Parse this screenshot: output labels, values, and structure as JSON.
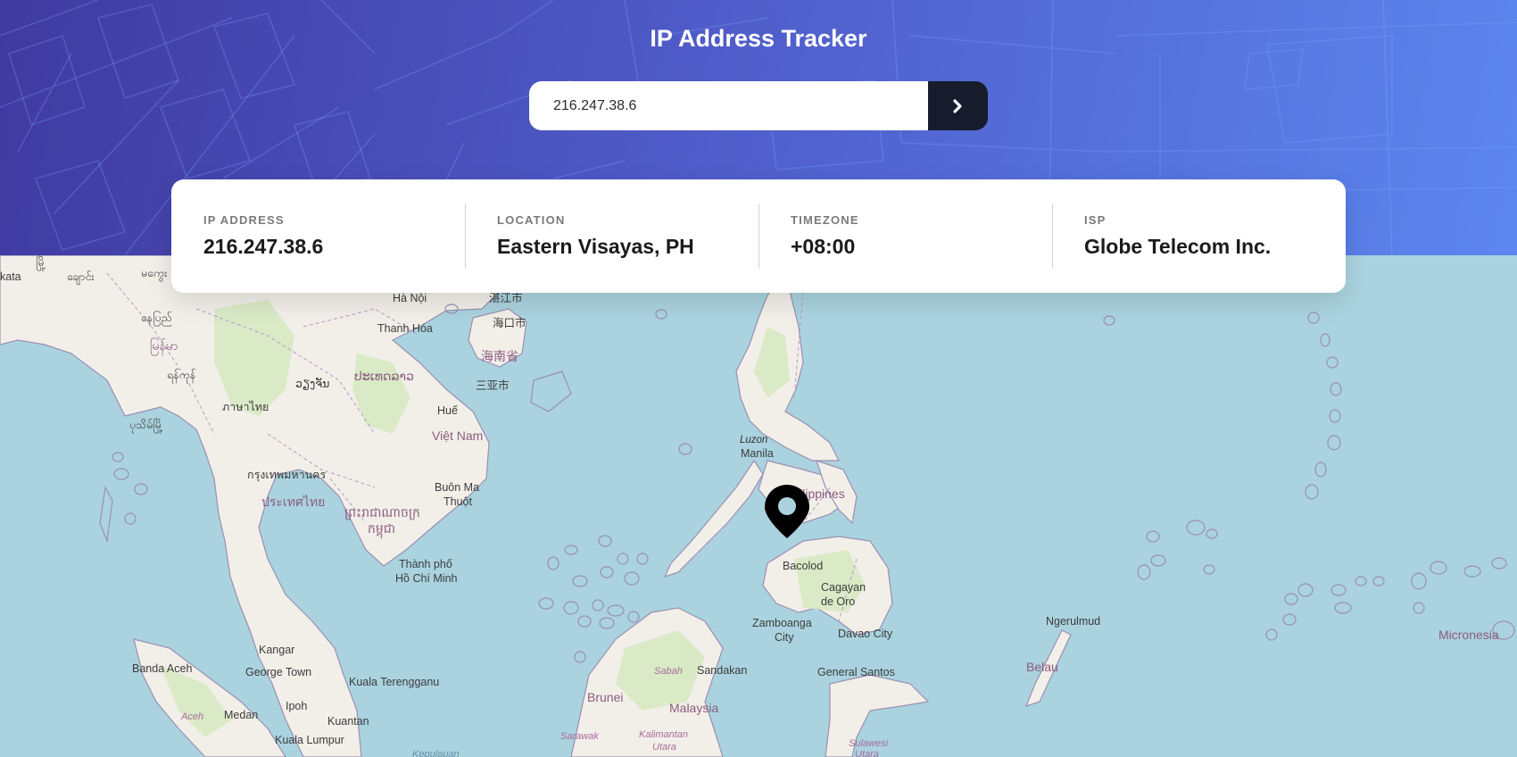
{
  "header": {
    "title": "IP Address Tracker",
    "background_start": "#3f3aa0",
    "background_end": "#5c86ee"
  },
  "search": {
    "value": "216.247.38.6",
    "button_icon": "chevron-right-icon",
    "button_color": "#161c2c"
  },
  "info": {
    "ip": {
      "label": "IP ADDRESS",
      "value": "216.247.38.6"
    },
    "location": {
      "label": "LOCATION",
      "value": "Eastern Visayas, PH"
    },
    "timezone": {
      "label": "TIMEZONE",
      "value": "+08:00"
    },
    "isp": {
      "label": "ISP",
      "value": "Globe Telecom Inc."
    }
  },
  "map": {
    "water_color": "#aad3df",
    "land_color": "#f2efe9",
    "marker_icon": "location-pin-icon",
    "labels": {
      "kolkata": "kata",
      "myanmar1": "မြို့",
      "myanmar2": "ချောင်း",
      "myanmar3": "မကွေး",
      "myanmar4": "မြန်မာ",
      "naypyidaw": "နေပြည်",
      "yangon": "ရန်ကုန်",
      "bago": "ပုသိမ်မြို့",
      "hanoi": "Hà Nội",
      "zhanjiang": "湛江市",
      "haikou": "海口市",
      "hainan": "海南省",
      "sanya": "三亚市",
      "thanhhoa": "Thanh Hóa",
      "laos1": "ປະເທດລາວ",
      "laos2": "ວຽງຈັນ",
      "thai1": "ภาษาไทย",
      "hue": "Huế",
      "vietnam": "Việt Nam",
      "bangkok": "กรุงเทพมหานคร",
      "thailand": "ประเทศไทย",
      "buonmathuot1": "Buôn Ma",
      "buonmathuot2": "Thuột",
      "cambodia1": "ព្រះរាជាណាចក្រ",
      "cambodia2": "កម្ពុជា",
      "hcmc1": "Thành phố",
      "hcmc2": "Hồ Chí Minh",
      "luzon": "Luzon",
      "manila": "Manila",
      "philippines": "Philippines",
      "bacolod": "Bacolod",
      "cagayan1": "Cagayan",
      "cagayan2": "de Oro",
      "zamboanga1": "Zamboanga",
      "zamboanga2": "City",
      "davao": "Davao City",
      "gensan": "General Santos",
      "ngerulmud": "Ngerulmud",
      "belau": "Belau",
      "micronesia": "Micronesia",
      "kangar": "Kangar",
      "bandaaceh": "Banda Aceh",
      "georgetown": "George Town",
      "kualaterengganu": "Kuala Terengganu",
      "aceh": "Aceh",
      "medan": "Medan",
      "ipoh": "Ipoh",
      "kuantan": "Kuantan",
      "kualalumpur": "Kuala Lumpur",
      "brunei": "Brunei",
      "sabah": "Sabah",
      "sandakan": "Sandakan",
      "malaysia": "Malaysia",
      "sarawak": "Sarawak",
      "kalimantan1": "Kalimantan",
      "kalimantan2": "Utara",
      "sulawesi1": "Sulawesi",
      "sulawesi2": "Utara",
      "kepulauan": "Kepulauan"
    }
  }
}
